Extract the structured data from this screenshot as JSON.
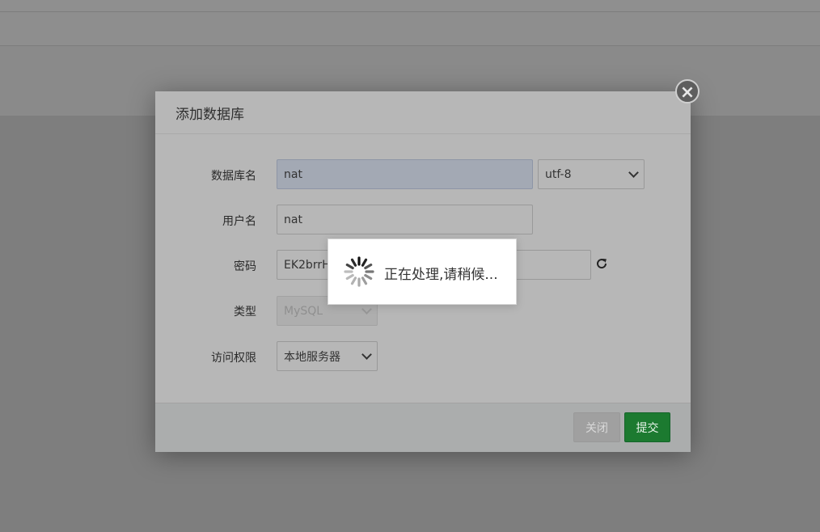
{
  "dialog": {
    "title": "添加数据库",
    "close_icon": "close-x-icon"
  },
  "form": {
    "db_name": {
      "label": "数据库名",
      "value": "nat"
    },
    "charset": {
      "value": "utf-8"
    },
    "username": {
      "label": "用户名",
      "value": "nat"
    },
    "password": {
      "label": "密码",
      "value": "EK2brrH",
      "refresh_icon": "refresh-icon"
    },
    "type": {
      "label": "类型",
      "value": "MySQL"
    },
    "access": {
      "label": "访问权限",
      "value": "本地服务器"
    }
  },
  "footer": {
    "close_label": "关闭",
    "submit_label": "提交"
  },
  "loading": {
    "text": "正在处理,请稍候..."
  },
  "colors": {
    "submit": "#1c7a30",
    "overlay": "#7e7e7e"
  }
}
